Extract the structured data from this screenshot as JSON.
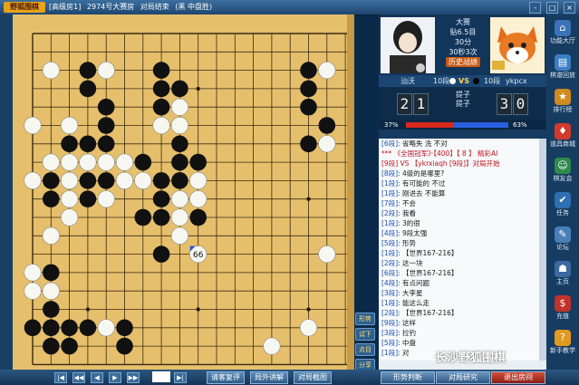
{
  "titlebar": {
    "logo": "野狐围棋",
    "breadcrumbs": [
      "[高级房1]",
      "2974号大赛房",
      "对局结束",
      "(黑 中盘胜)"
    ],
    "window_buttons": [
      "-",
      "□",
      "×"
    ]
  },
  "players": {
    "info_title": "大赛",
    "info_rules": "贴6.5目",
    "info_time": "30分",
    "info_byoyomi": "30秒3次",
    "info_badge": "历史战绩",
    "left_name": "汕沃",
    "left_rank": "10段",
    "vs": "VS",
    "right_rank": "10段",
    "right_name": "ykpcx"
  },
  "score": {
    "left_digits": [
      "2",
      "1"
    ],
    "right_digits": [
      "3",
      "0"
    ],
    "mid_top": "提子",
    "mid_bottom": "提子",
    "left_pct": "37%",
    "right_pct": "63%"
  },
  "board": {
    "labeled_stone": "66"
  },
  "board_tools": [
    "形势",
    "试下",
    "点目",
    "分享"
  ],
  "chat": [
    {
      "u": "[6段]:",
      "t": " 省略失 洗 不对"
    },
    {
      "r": "*** 《全国冠军》·【400】【 8 】 精彩AI"
    },
    {
      "r": "[9段] VS 【ykrxiaqh [9段]】对局开始"
    },
    {
      "u": "[8段]:",
      "t": " 4级的是哪里?"
    },
    {
      "u": "[1段]:",
      "t": " 有可能的 不过"
    },
    {
      "u": "[1段]:",
      "t": " 刚进去 不能算"
    },
    {
      "u": "[7段]:",
      "t": " 不会"
    },
    {
      "u": "[2段]:",
      "t": " 我看"
    },
    {
      "u": "[1段]:",
      "t": " 3的很"
    },
    {
      "u": "[4段]:",
      "t": " 9段太强"
    },
    {
      "u": "[5段]:",
      "t": " 形势"
    },
    {
      "u": "[1段]:",
      "t": " 【世界167-216】"
    },
    {
      "u": "[2段]:",
      "t": " 这一块"
    },
    {
      "u": "[6段]:",
      "t": " 【世界167-216】"
    },
    {
      "u": "[4段]:",
      "t": " 有点问题"
    },
    {
      "u": "[3段]:",
      "t": " 大李星"
    },
    {
      "u": "[1段]:",
      "t": " 能这么走"
    },
    {
      "u": "[2段]:",
      "t": " 【世界167-216】"
    },
    {
      "u": "[9段]:",
      "t": " 这样"
    },
    {
      "u": "[3段]:",
      "t": " 拉钓"
    },
    {
      "u": "[5段]:",
      "t": " 中盘"
    },
    {
      "u": "[1段]:",
      "t": " 对"
    }
  ],
  "bottom": {
    "move_number": "",
    "buttons": [
      "请客复评",
      "局外讲解",
      "对局截图"
    ]
  },
  "tabs": [
    "形势判断",
    "对局研究",
    "退出房间"
  ],
  "sidebar": [
    {
      "label": "功能大厅",
      "icon": "home-icon",
      "color": "#3a73b6"
    },
    {
      "label": "棋谱回放",
      "icon": "record-icon",
      "color": "#3c7ec4"
    },
    {
      "label": "排行榜",
      "icon": "trophy-icon",
      "color": "#d08a1f"
    },
    {
      "label": "道具商城",
      "icon": "shop-icon",
      "color": "#d23a2c"
    },
    {
      "label": "棋友会",
      "icon": "people-icon",
      "color": "#2e8a4c"
    },
    {
      "label": "任务",
      "icon": "task-icon",
      "color": "#2d6fb0"
    },
    {
      "label": "论坛",
      "icon": "forum-icon",
      "color": "#4a7fb7"
    },
    {
      "label": "主页",
      "icon": "profile-icon",
      "color": "#3a6aa0"
    },
    {
      "label": "充值",
      "icon": "coin-icon",
      "color": "#c2332b"
    },
    {
      "label": "新手教学",
      "icon": "teach-icon",
      "color": "#e09a1f"
    }
  ],
  "watermark": "长沙野狐围棋"
}
